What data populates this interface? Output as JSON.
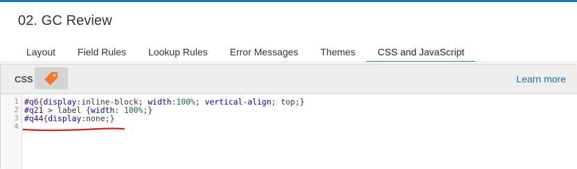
{
  "page": {
    "title": "02. GC Review"
  },
  "tabs": [
    {
      "label": "Layout",
      "active": false
    },
    {
      "label": "Field Rules",
      "active": false
    },
    {
      "label": "Lookup Rules",
      "active": false
    },
    {
      "label": "Error Messages",
      "active": false
    },
    {
      "label": "Themes",
      "active": false
    },
    {
      "label": "CSS and JavaScript",
      "active": true
    }
  ],
  "panel": {
    "label": "CSS",
    "tag_icon": "tag-icon",
    "learn_more": "Learn more"
  },
  "editor": {
    "line_numbers": [
      "1",
      "2",
      "3",
      "4"
    ],
    "lines": [
      {
        "tokens": [
          {
            "text": "#q6",
            "kind": "sel"
          },
          {
            "text": "{",
            "kind": "punc"
          },
          {
            "text": "display",
            "kind": "prop"
          },
          {
            "text": ":",
            "kind": "punc"
          },
          {
            "text": "inline-block",
            "kind": "plain"
          },
          {
            "text": "; ",
            "kind": "punc"
          },
          {
            "text": "width",
            "kind": "prop"
          },
          {
            "text": ":",
            "kind": "punc"
          },
          {
            "text": "100%",
            "kind": "num"
          },
          {
            "text": "; ",
            "kind": "punc"
          },
          {
            "text": "vertical-align",
            "kind": "prop"
          },
          {
            "text": "; ",
            "kind": "punc"
          },
          {
            "text": "top",
            "kind": "plain"
          },
          {
            "text": ";}",
            "kind": "punc"
          }
        ]
      },
      {
        "tokens": [
          {
            "text": "#q21",
            "kind": "sel"
          },
          {
            "text": " > ",
            "kind": "punc"
          },
          {
            "text": "label",
            "kind": "plain"
          },
          {
            "text": " {",
            "kind": "punc"
          },
          {
            "text": "width",
            "kind": "prop"
          },
          {
            "text": ": ",
            "kind": "punc"
          },
          {
            "text": "100%",
            "kind": "num"
          },
          {
            "text": ";}",
            "kind": "punc"
          }
        ]
      },
      {
        "tokens": [
          {
            "text": "#q44",
            "kind": "sel"
          },
          {
            "text": "{",
            "kind": "punc"
          },
          {
            "text": "display",
            "kind": "prop"
          },
          {
            "text": ":",
            "kind": "punc"
          },
          {
            "text": "none",
            "kind": "plain"
          },
          {
            "text": ";}",
            "kind": "punc"
          }
        ]
      },
      {
        "tokens": []
      }
    ],
    "annotation_color": "#d0201a"
  },
  "colors": {
    "accent_top": "#1a73c6",
    "active_tab_underline": "#1f9f8a",
    "tag_orange": "#f07a2a",
    "link": "#1a6fbf"
  }
}
